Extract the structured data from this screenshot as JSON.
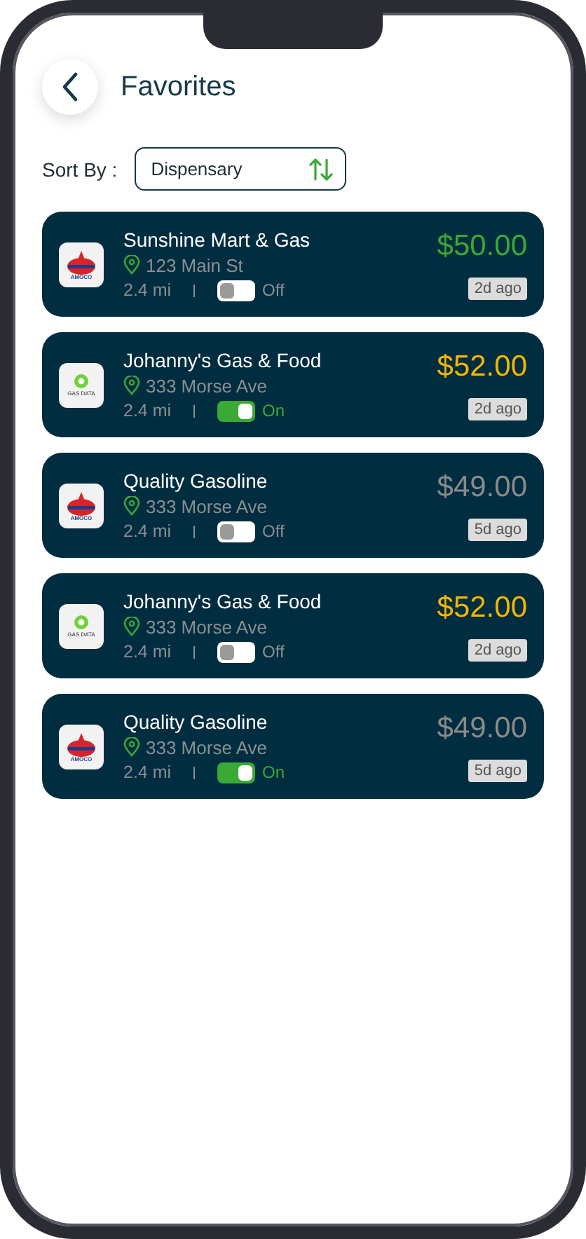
{
  "header": {
    "title": "Favorites"
  },
  "sort": {
    "label": "Sort By :",
    "value": "Dispensary"
  },
  "stations": [
    {
      "name": "Sunshine Mart & Gas",
      "address": "123 Main St",
      "distance": "2.4 mi",
      "on": false,
      "toggle_label": "Off",
      "price": "$50.00",
      "color": "#3aa935",
      "updated": "2d ago",
      "logo": {
        "kind": "amoco",
        "text": "AMOCO"
      }
    },
    {
      "name": "Johanny's Gas & Food",
      "address": "333 Morse Ave",
      "distance": "2.4 mi",
      "on": true,
      "toggle_label": "On",
      "price": "$52.00",
      "color": "#f2b705",
      "updated": "2d ago",
      "logo": {
        "kind": "gasdata",
        "text": "GAS DATA"
      }
    },
    {
      "name": "Quality Gasoline",
      "address": "333 Morse Ave",
      "distance": "2.4 mi",
      "on": false,
      "toggle_label": "Off",
      "price": "$49.00",
      "color": "#8a8a8a",
      "updated": "5d ago",
      "logo": {
        "kind": "amoco",
        "text": "AMOCO"
      }
    },
    {
      "name": "Johanny's Gas & Food",
      "address": "333 Morse Ave",
      "distance": "2.4 mi",
      "on": false,
      "toggle_label": "Off",
      "price": "$52.00",
      "color": "#f2b705",
      "updated": "2d ago",
      "logo": {
        "kind": "gasdata",
        "text": "GAS DATA"
      }
    },
    {
      "name": "Quality Gasoline",
      "address": "333 Morse Ave",
      "distance": "2.4 mi",
      "on": true,
      "toggle_label": "On",
      "price": "$49.00",
      "color": "#8a8a8a",
      "updated": "5d ago",
      "logo": {
        "kind": "amoco",
        "text": "AMOCO"
      }
    }
  ]
}
